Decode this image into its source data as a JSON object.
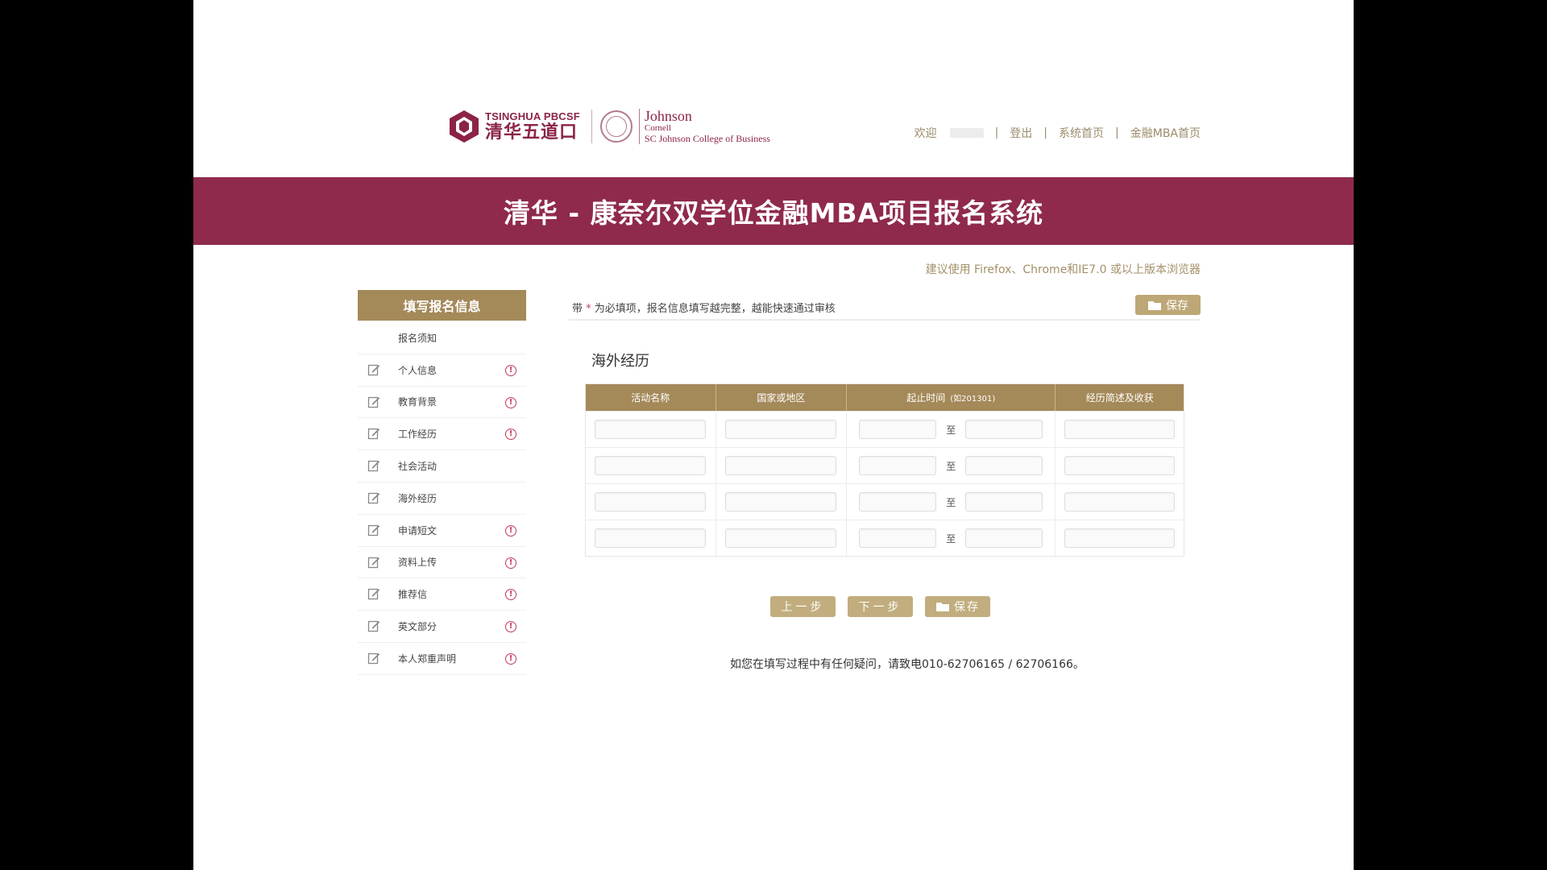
{
  "header": {
    "logo_tsinghua_en": "TSINGHUA PBCSF",
    "logo_tsinghua_cn": "清华五道口",
    "logo_johnson_1": "Johnson",
    "logo_johnson_2": "Cornell",
    "logo_johnson_3": "SC Johnson College of Business",
    "nav": {
      "welcome": "欢迎",
      "logout": "登出",
      "system_home": "系统首页",
      "mba_home": "金融MBA首页"
    }
  },
  "banner": {
    "title": "清华 - 康奈尔双学位金融MBA项目报名系统"
  },
  "browser_tip": "建议使用 Firefox、Chrome和IE7.0 或以上版本浏览器",
  "sidebar": {
    "title": "填写报名信息",
    "items": [
      {
        "label": "报名须知",
        "icon": false,
        "warn": false
      },
      {
        "label": "个人信息",
        "icon": true,
        "warn": true
      },
      {
        "label": "教育背景",
        "icon": true,
        "warn": true
      },
      {
        "label": "工作经历",
        "icon": true,
        "warn": true
      },
      {
        "label": "社会活动",
        "icon": true,
        "warn": false
      },
      {
        "label": "海外经历",
        "icon": true,
        "warn": false
      },
      {
        "label": "申请短文",
        "icon": true,
        "warn": true
      },
      {
        "label": "资料上传",
        "icon": true,
        "warn": true
      },
      {
        "label": "推荐信",
        "icon": true,
        "warn": true
      },
      {
        "label": "英文部分",
        "icon": true,
        "warn": true
      },
      {
        "label": "本人郑重声明",
        "icon": true,
        "warn": true
      }
    ],
    "warn_glyph": "!"
  },
  "main": {
    "required_prefix": "带",
    "required_star": "*",
    "required_text": "为必填项，报名信息填写越完整，越能快速通过审核",
    "save_top": "保存",
    "section_title": "海外经历",
    "table": {
      "headers": [
        "活动名称",
        "国家或地区",
        "起止时间",
        "经历简述及收获"
      ],
      "date_hint": "(如201301)",
      "to_label": "至",
      "row_count": 4
    },
    "buttons": {
      "prev": "上一步",
      "next": "下一步",
      "save": "保存"
    },
    "contact": "如您在填写过程中有任何疑问，请致电010-62706165 / 62706166。"
  },
  "colors": {
    "brand": "#8f2a4c",
    "gold": "#a48959",
    "warn": "#c0395a"
  }
}
